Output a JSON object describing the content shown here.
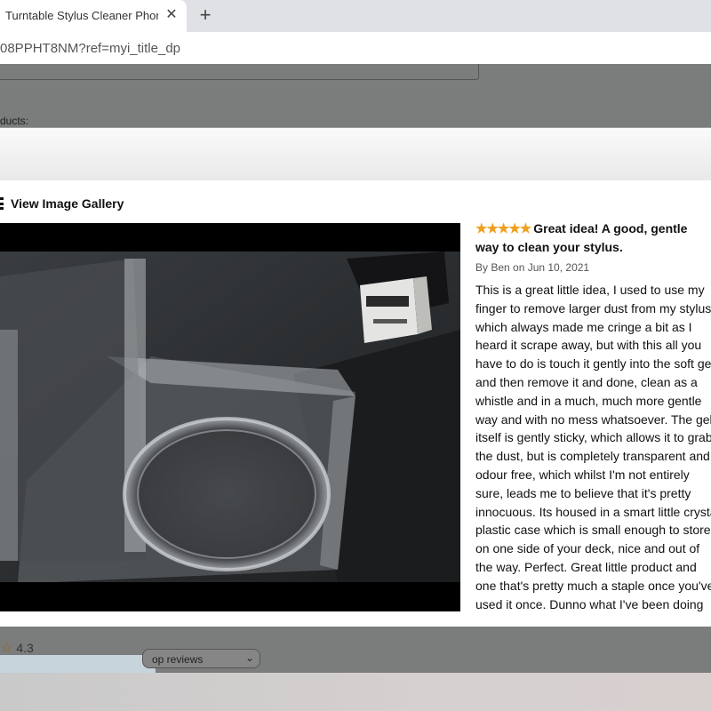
{
  "browser": {
    "tab_title": "Turntable Stylus Cleaner Phono",
    "tab_close_icon": "close-icon",
    "new_tab_icon": "plus-icon",
    "url": "08PPHT8NM?ref=myi_title_dp"
  },
  "page": {
    "products_label": "ducts:",
    "rating": "4.3",
    "sort_value": "op reviews"
  },
  "modal": {
    "gallery_label": "View Image Gallery",
    "photo_icon": "product-photo",
    "review": {
      "stars": "★★★★★",
      "rating": 5,
      "title": "Great idea! A good, gentle way to clean your stylus.",
      "byline": "By Ben on Jun 10, 2021",
      "body_lines": [
        "This is a great little idea, I used to use my",
        "finger to remove larger dust from my stylus",
        "which always made me cringe a bit as I",
        "heard it scrape away, but with this all you",
        "have to do is touch it gently into the soft gel",
        "and then remove it and done, clean as a",
        "whistle and in a much, much more gentle",
        "way and with no mess whatsoever. The gel",
        "itself is gently sticky, which allows it to grab",
        "the dust, but is completely transparent and",
        "odour free, which whilst I'm not entirely",
        "sure, leads me to believe that it's pretty",
        "innocuous. Its housed in a smart little crystal",
        "plastic case which is small enough to store",
        "on one side of your deck, nice and out of",
        "the way. Perfect. Great little product and",
        "one that's pretty much a staple once you've",
        "used it once. Dunno what I've been doing"
      ]
    }
  },
  "colors": {
    "star": "#f0a01f",
    "overlay": "#7b7c7c"
  }
}
